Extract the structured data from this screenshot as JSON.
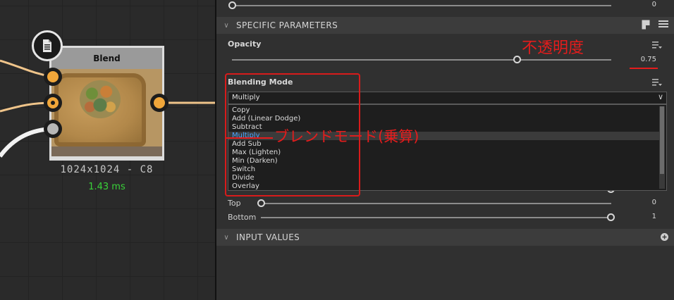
{
  "graph": {
    "node": {
      "title": "Blend",
      "resolution": "1024x1024 - C8",
      "time": "1.43 ms"
    }
  },
  "panel": {
    "top_slider_value": "0",
    "specific_parameters": {
      "title": "SPECIFIC PARAMETERS",
      "opacity": {
        "label": "Opacity",
        "value": "0.75",
        "fraction": 0.75
      },
      "blending_mode": {
        "label": "Blending Mode",
        "selected": "Multiply",
        "options": [
          "Copy",
          "Add (Linear Dodge)",
          "Subtract",
          "Multiply",
          "Add Sub",
          "Max (Lighten)",
          "Min (Darken)",
          "Switch",
          "Divide",
          "Overlay"
        ]
      },
      "top": {
        "label": "Top",
        "value": "0"
      },
      "bottom": {
        "label": "Bottom",
        "value": "1"
      }
    },
    "input_values": {
      "title": "INPUT VALUES"
    }
  },
  "annotations": {
    "opacity_note": "不透明度",
    "blend_note": "ブレンドモード(乗算)",
    "color": "#e51c1c"
  }
}
